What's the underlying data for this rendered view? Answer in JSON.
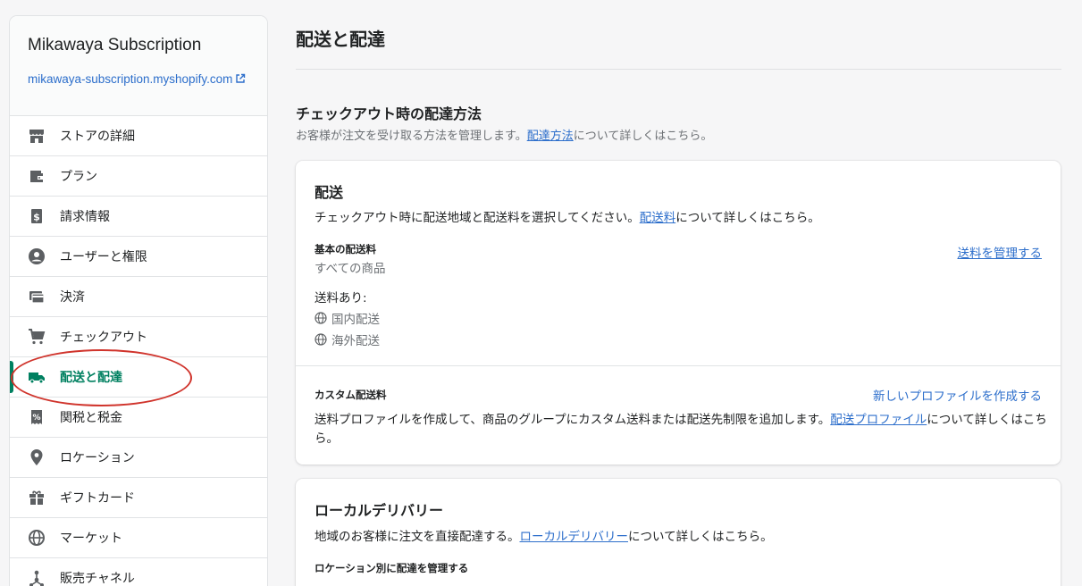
{
  "store": {
    "name": "Mikawaya Subscription",
    "url": "mikawaya-subscription.myshopify.com"
  },
  "sidebar": {
    "items": [
      {
        "label": "ストアの詳細",
        "icon": "store-icon"
      },
      {
        "label": "プラン",
        "icon": "wallet-icon"
      },
      {
        "label": "請求情報",
        "icon": "bill-icon"
      },
      {
        "label": "ユーザーと権限",
        "icon": "user-icon"
      },
      {
        "label": "決済",
        "icon": "payment-icon"
      },
      {
        "label": "チェックアウト",
        "icon": "cart-icon"
      },
      {
        "label": "配送と配達",
        "icon": "truck-icon",
        "active": true
      },
      {
        "label": "関税と税金",
        "icon": "tax-icon"
      },
      {
        "label": "ロケーション",
        "icon": "location-icon"
      },
      {
        "label": "ギフトカード",
        "icon": "gift-icon"
      },
      {
        "label": "マーケット",
        "icon": "globe-icon"
      },
      {
        "label": "販売チャネル",
        "icon": "channel-icon"
      }
    ]
  },
  "main": {
    "page_title": "配送と配達",
    "section_title": "チェックアウト時の配達方法",
    "section_sub_prefix": "お客様が注文を受け取る方法を管理します。",
    "section_sub_link": "配達方法",
    "section_sub_suffix": "について詳しくはこちら。",
    "shipping_card": {
      "title": "配送",
      "desc_prefix": "チェックアウト時に配送地域と配送料を選択してください。",
      "desc_link": "配送料",
      "desc_suffix": "について詳しくはこちら。",
      "general_rates_label": "基本の配送料",
      "general_rates_products": "すべての商品",
      "manage_rates_link": "送料を管理する",
      "rates_for": "送料あり:",
      "zones": [
        "国内配送",
        "海外配送"
      ],
      "custom_label": "カスタム配送料",
      "create_profile_link": "新しいプロファイルを作成する",
      "custom_desc_prefix": "送料プロファイルを作成して、商品のグループにカスタム送料または配送先制限を追加します。",
      "custom_desc_link": "配送プロファイル",
      "custom_desc_suffix": "について詳しくはこちら。"
    },
    "local_card": {
      "title": "ローカルデリバリー",
      "desc_prefix": "地域のお客様に注文を直接配達する。",
      "desc_link": "ローカルデリバリー",
      "desc_suffix": "について詳しくはこちら。",
      "manage_label": "ロケーション別に配達を管理する"
    }
  },
  "colors": {
    "accent_green": "#008060",
    "link_blue": "#2c6ecb",
    "annotation_red": "#d0342c"
  }
}
